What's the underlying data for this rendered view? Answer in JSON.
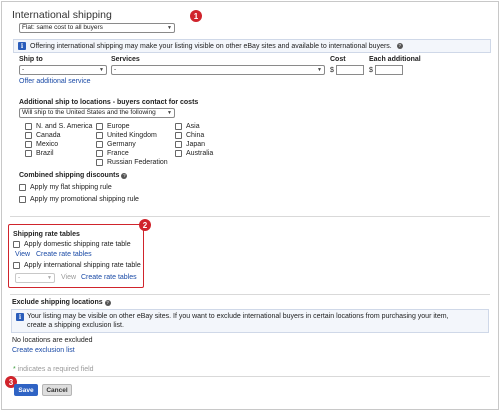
{
  "title": "International shipping",
  "markers": [
    "1",
    "2",
    "3"
  ],
  "shipping_type": {
    "value": "Flat: same cost to all buyers"
  },
  "info_banner": {
    "text": "Offering international shipping may make your listing visible on other eBay sites and available to international buyers."
  },
  "services_table": {
    "headers": {
      "ship_to": "Ship to",
      "services": "Services",
      "cost": "Cost",
      "each_additional": "Each additional"
    },
    "row": {
      "ship_to": "-",
      "service": "-",
      "cost_prefix": "$",
      "each_prefix": "$"
    },
    "offer_link": "Offer additional service"
  },
  "additional_locations": {
    "label": "Additional ship to locations - buyers contact for costs",
    "select_value": "Will ship to the United States and the following",
    "columns": [
      [
        "N. and S. America",
        "Canada",
        "Mexico",
        "Brazil"
      ],
      [
        "Europe",
        "United Kingdom",
        "Germany",
        "France",
        "Russian Federation"
      ],
      [
        "Asia",
        "China",
        "Japan",
        "Australia"
      ]
    ]
  },
  "combined_discounts": {
    "label": "Combined shipping discounts",
    "options": [
      "Apply my flat shipping rule",
      "Apply my promotional shipping rule"
    ]
  },
  "rate_tables": {
    "label": "Shipping rate tables",
    "domestic_label": "Apply domestic shipping rate table",
    "view": "View",
    "create": "Create rate tables",
    "international_label": "Apply international shipping rate table",
    "select_value": "-",
    "view2": "View",
    "create2": "Create rate tables"
  },
  "exclude": {
    "label": "Exclude shipping locations",
    "info": "Your listing may be visible on other eBay sites. If you want to exclude international buyers in certain locations from purchasing your item, create a shipping exclusion list.",
    "none_text": "No locations are excluded",
    "create_link": "Create exclusion list"
  },
  "required_note": {
    "star": "*",
    "text": "indicates a required field"
  },
  "buttons": {
    "save": "Save",
    "cancel": "Cancel"
  },
  "colors": {
    "marker": "#d0242c",
    "link": "#1a4aa6",
    "save": "#2f63c4",
    "info_icon": "#2a5dbb"
  }
}
